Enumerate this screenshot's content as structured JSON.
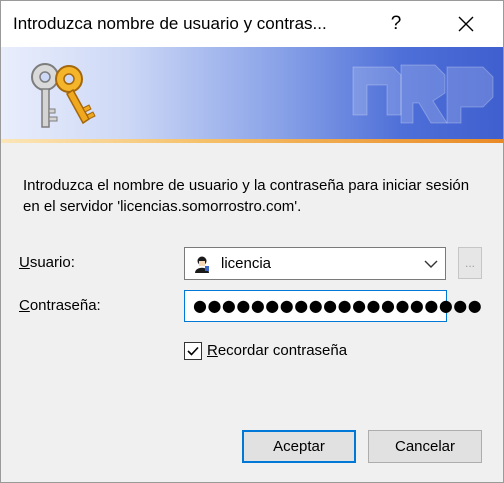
{
  "window": {
    "title": "Introduzca nombre de usuario y contras...",
    "help_label": "?"
  },
  "dialog": {
    "description": "Introduzca el nombre de usuario y la contraseña para iniciar sesión en el servidor 'licencias.somorrostro.com'.",
    "user_label_access": "U",
    "user_label_rest": "suario:",
    "password_label_access": "C",
    "password_label_rest": "ontraseña:",
    "user_value": "licencia",
    "password_value": "●●●●●●●●●●●●●●●●●●●●",
    "browse_label": "...",
    "remember_access": "R",
    "remember_rest": "ecordar contraseña",
    "remember_checked": true
  },
  "buttons": {
    "accept": "Aceptar",
    "cancel": "Cancelar"
  },
  "colors": {
    "accent": "#0078d7",
    "banner_blue": "#3f5fcf",
    "stripe_orange": "#e98a26"
  },
  "icons": {
    "banner": "keys-icon",
    "user": "user-avatar-icon",
    "dropdown": "chevron-down-icon",
    "close": "close-icon"
  }
}
